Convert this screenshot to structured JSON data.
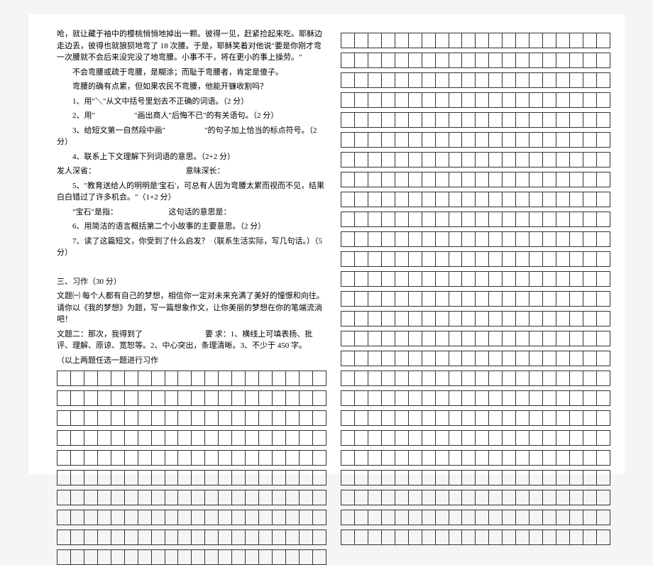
{
  "leftColumn": {
    "story": [
      "呛，就让藏于袖中的樱桃悄悄地掉出一颗。彼得一见，赶紧捡起来吃。耶稣边走边丢，彼得也就狼狈地弯了 18 次腰。于是，耶稣笑着对他说\"要是你刚才弯一次腰就不会后来没完没了地弯腰。小事不干，将在更小的事上操劳。\"",
      "不会弯腰或疏于弯腰，是糊涂；而耻于弯腰者，肯定是傻子。",
      "弯腰的确有点累，但如果农民不弯腰，他能开镰收割吗？"
    ],
    "questions": [
      "1、用\"＼\"从文中括号里划去不正确的词语。（2 分）",
      "2、用\"　　　　　\"画出商人\"后悔不已\"的有关语句。（2 分）",
      "3、给短文第一自然段中画\"　　　　　\"的句子加上恰当的标点符号。（2 分）",
      "4、联系上下文理解下列词语的意思。（2+2 分）",
      "发人深省：　　　　　　　　　　　　意味深长：",
      "5、\"教育送给人的明明是'宝石'，可总有人因为弯腰太累而视而不见，结果白白错过了许多机会。\"（1+2 分）",
      "\"宝石\"是指：　　　　　　　这句话的意思是：",
      "6、用简洁的语言概括第二个小故事的主要意思。（2 分）",
      "",
      "7、读了这篇短文，你受到了什么启发？（联系生活实际，写几句话。）（5 分）"
    ],
    "composition": {
      "heading": "三、习作（30 分）",
      "topic1": "文题㈠ 每个人都有自己的梦想，相信你一定对未来充满了美好的憧憬和向往。请你以《我的梦想》为题，写一篇想象作文，让你美丽的梦想在你的笔端流淌吧！",
      "topic2": "文题二：那次，我得到了　　　　　　　　要 求：1、横线上可填表扬、批评、理解、原谅、宽恕等。2、中心突出，条理清晰。3、不少于 450 字。",
      "note": "（以上两题任选一题进行习作"
    }
  },
  "grid": {
    "columns": 20,
    "leftRows": 10,
    "rightRows": 26
  }
}
